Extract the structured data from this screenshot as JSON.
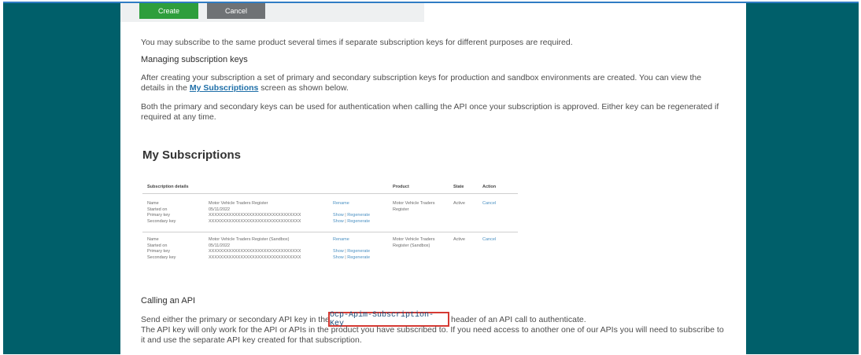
{
  "buttons": {
    "create": "Create",
    "cancel": "Cancel"
  },
  "intro_text": "You may subscribe to the same product several times if separate subscription keys for different purposes are required.",
  "managing": {
    "heading": "Managing subscription keys",
    "p1_line1": "After creating your subscription a set of primary and secondary subscription keys for production and sandbox environments are created. You can view the",
    "p1_line2_before": "details in the ",
    "p1_link": "My Subscriptions",
    "p1_line2_after": " screen as shown below.",
    "p2_line1": "Both the primary and secondary keys can be used for authentication when calling the API once your subscription is approved. Either key can be regenerated if",
    "p2_line2": "required at any time."
  },
  "subscriptions": {
    "title": "My Subscriptions",
    "headers": {
      "details": "Subscription details",
      "product": "Product",
      "state": "State",
      "action": "Action"
    },
    "field_labels": "Name\nStarted on\nPrimary key\nSecondary key",
    "rename": "Rename",
    "show": "Show",
    "regenerate": "Regenerate",
    "sep": "|",
    "rows": [
      {
        "values": "Motor Vehicle Traders Register\n05/11/2022\nXXXXXXXXXXXXXXXXXXXXXXXXXXXXXXXX\nXXXXXXXXXXXXXXXXXXXXXXXXXXXXXXXX",
        "product": "Motor Vehicle Traders\nRegister",
        "state": "Active",
        "action": "Cancel"
      },
      {
        "values": "Motor Vehicle Traders Register (Sandbox)\n05/11/2022\nXXXXXXXXXXXXXXXXXXXXXXXXXXXXXXXX\nXXXXXXXXXXXXXXXXXXXXXXXXXXXXXXXX",
        "product": "Motor Vehicle Traders\nRegister (Sandbox)",
        "state": "Active",
        "action": "Cancel"
      }
    ]
  },
  "calling": {
    "heading": "Calling an API",
    "line1_before": "Send either the primary or secondary API key in the ",
    "header_name": "Ocp-Apim-Subscription-Key",
    "line1_after": "header of an API call to authenticate.",
    "line2": "The API key will only work for the API or APIs in the product you have subscribed to. If you need access to another one of our APIs you will need to subscribe to",
    "line3": "it and use the separate API key created for that subscription."
  },
  "colors": {
    "background": "#005f6a",
    "create_button": "#2e9e3c",
    "cancel_button": "#6f7275",
    "link": "#1f6fa8",
    "callout_border": "#d53a33"
  }
}
